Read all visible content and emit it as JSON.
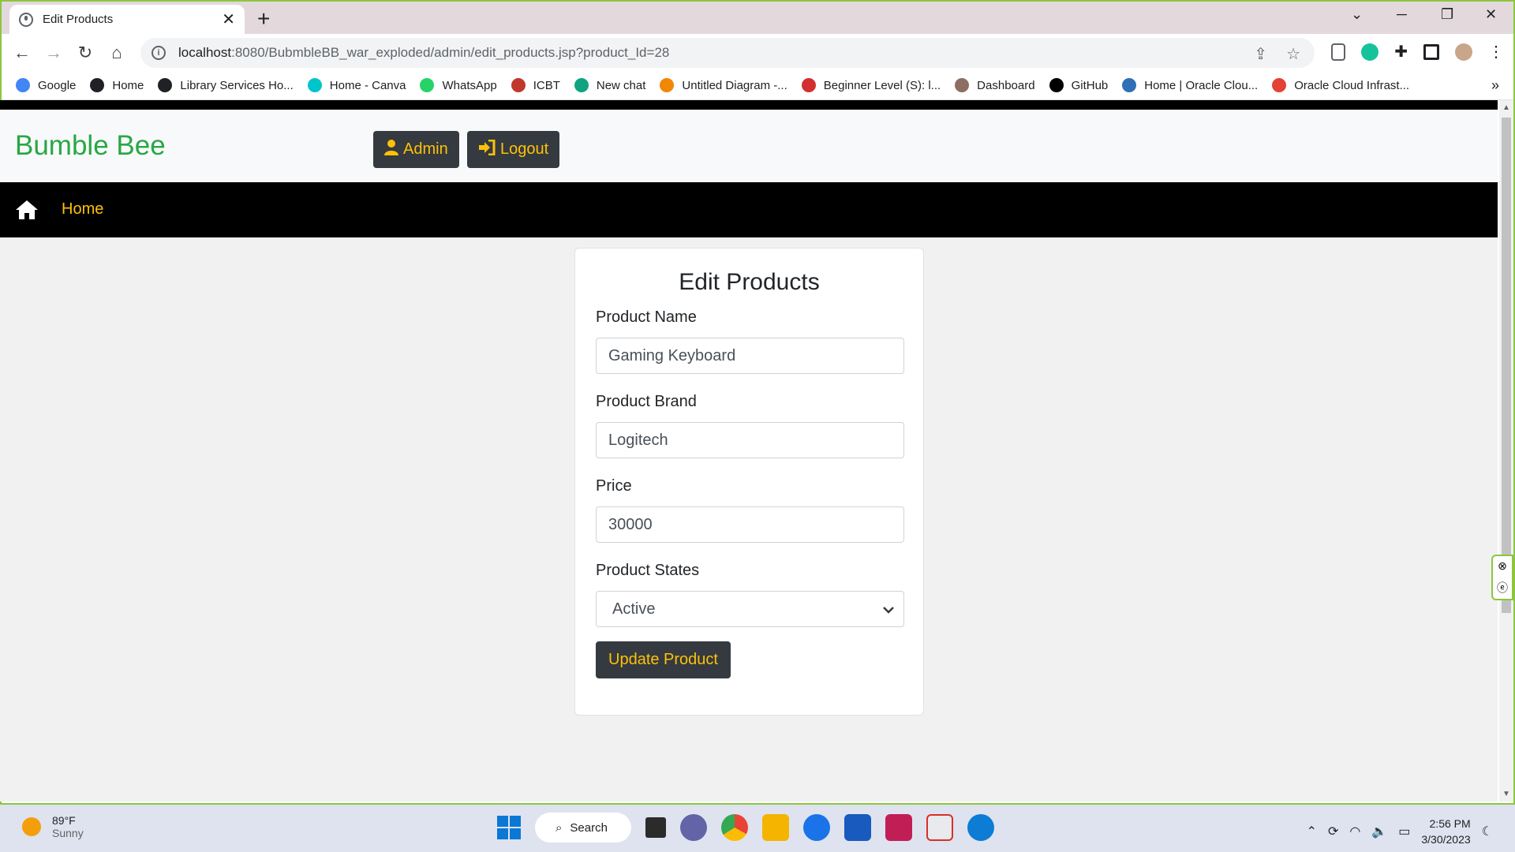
{
  "browser": {
    "tab_title": "Edit Products",
    "url_host": "localhost",
    "url_rest": ":8080/BubmbleBB_war_exploded/admin/edit_products.jsp?product_Id=28",
    "bookmarks": [
      {
        "label": "Google",
        "color": "#4285f4"
      },
      {
        "label": "Home",
        "color": "#202124"
      },
      {
        "label": "Library Services Ho...",
        "color": "#202124"
      },
      {
        "label": "Home - Canva",
        "color": "#00c4cc"
      },
      {
        "label": "WhatsApp",
        "color": "#25d366"
      },
      {
        "label": "ICBT",
        "color": "#c0392b"
      },
      {
        "label": "New chat",
        "color": "#10a37f"
      },
      {
        "label": "Untitled Diagram -...",
        "color": "#f08705"
      },
      {
        "label": "Beginner Level (S): l...",
        "color": "#d32f2f"
      },
      {
        "label": "Dashboard",
        "color": "#8d6e63"
      },
      {
        "label": "GitHub",
        "color": "#000000"
      },
      {
        "label": "Home | Oracle Clou...",
        "color": "#2f6fb5"
      },
      {
        "label": "Oracle Cloud Infrast...",
        "color": "#e34234"
      }
    ]
  },
  "site": {
    "brand": "Bumble Bee",
    "admin_label": "Admin",
    "logout_label": "Logout",
    "nav_home": "Home",
    "accent_color": "#ffc107",
    "brand_color": "#28a745"
  },
  "form": {
    "title": "Edit Products",
    "product_name_label": "Product Name",
    "product_name_value": "Gaming Keyboard",
    "product_brand_label": "Product Brand",
    "product_brand_value": "Logitech",
    "price_label": "Price",
    "price_value": "30000",
    "states_label": "Product States",
    "states_selected": "Active",
    "submit_label": "Update Product"
  },
  "taskbar": {
    "temperature": "89°F",
    "condition": "Sunny",
    "search_label": "Search",
    "time": "2:56 PM",
    "date": "3/30/2023"
  }
}
